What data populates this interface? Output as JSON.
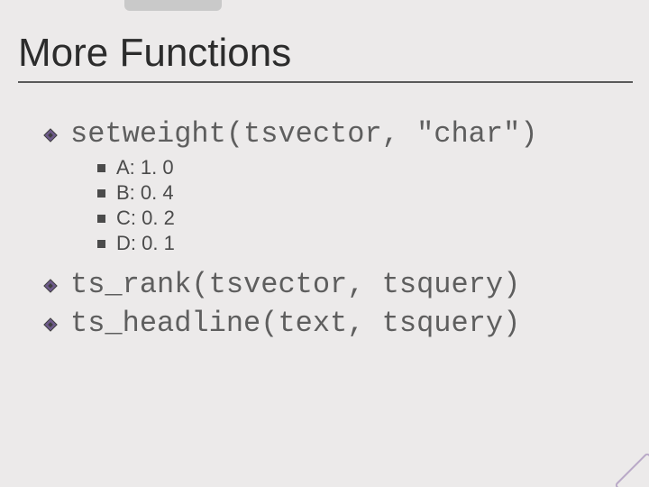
{
  "title": "More Functions",
  "items": [
    {
      "code": "setweight(tsvector, \"char\")",
      "sub": [
        "A: 1. 0",
        "B: 0. 4",
        "C: 0. 2",
        "D: 0. 1"
      ]
    },
    {
      "code": "ts_rank(tsvector, tsquery)"
    },
    {
      "code": "ts_headline(text, tsquery)"
    }
  ]
}
